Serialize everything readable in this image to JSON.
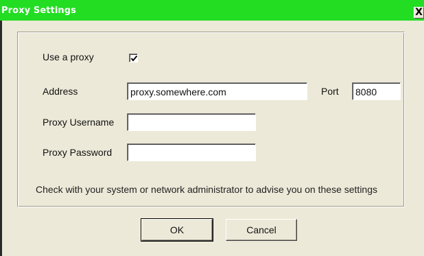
{
  "window": {
    "title": "Proxy Settings",
    "close_glyph": "X",
    "titlebar_color": "#22dd22"
  },
  "form": {
    "use_proxy_label": "Use a proxy",
    "use_proxy_checked": true,
    "address_label": "Address",
    "address_value": "proxy.somewhere.com",
    "port_label": "Port",
    "port_value": "8080",
    "username_label": "Proxy Username",
    "username_value": "",
    "password_label": "Proxy Password",
    "password_value": "",
    "hint": "Check with your system or network administrator to advise you on these settings"
  },
  "buttons": {
    "ok_label": "OK",
    "cancel_label": "Cancel"
  }
}
